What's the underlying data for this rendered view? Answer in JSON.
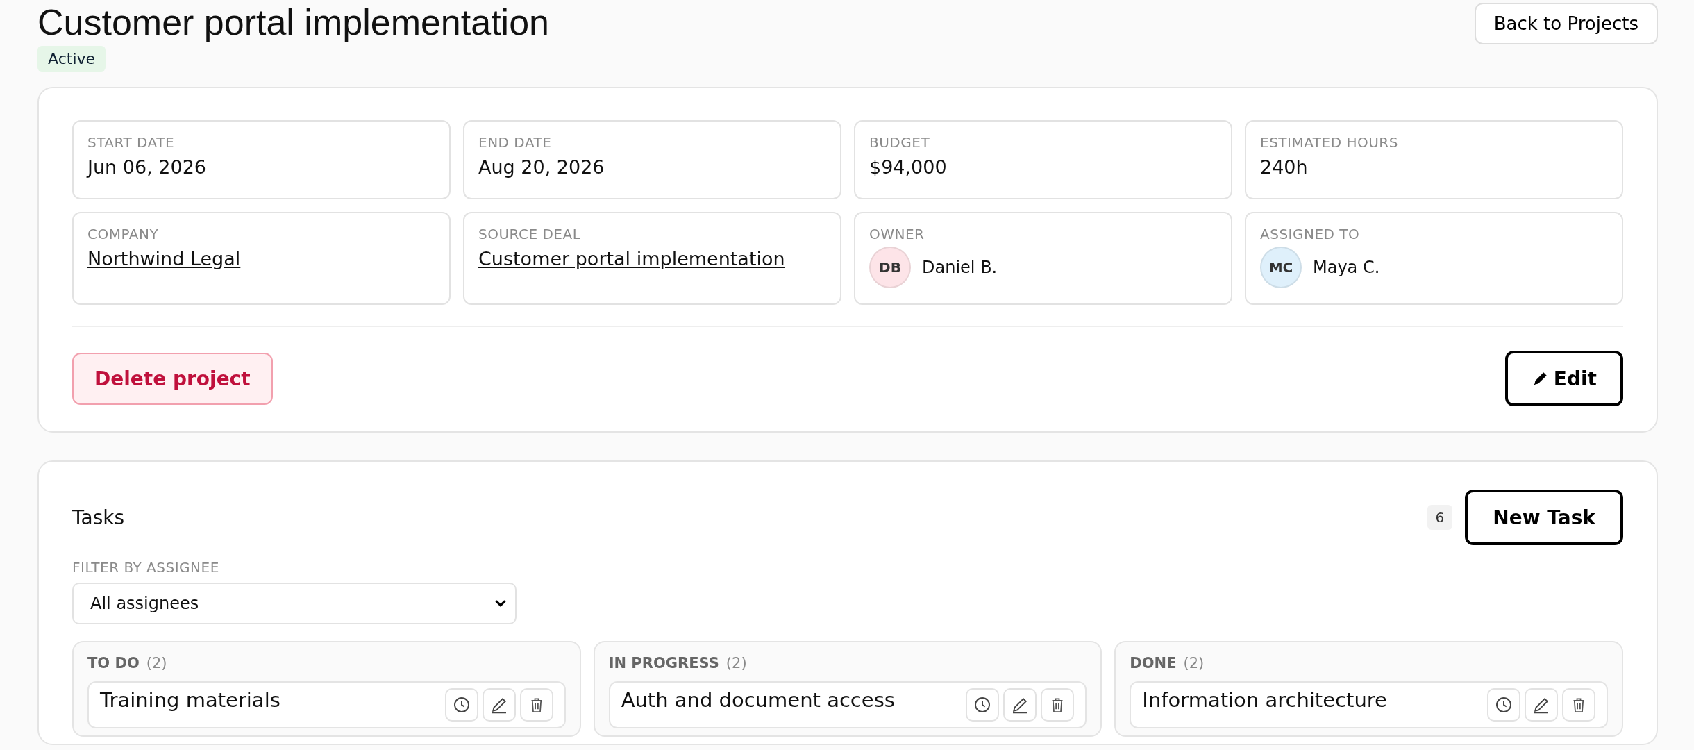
{
  "header": {
    "title": "Customer portal implementation",
    "status": "Active",
    "back_button": "Back to Projects"
  },
  "details": [
    {
      "kind": "text",
      "label": "START DATE",
      "value": "Jun 06, 2026"
    },
    {
      "kind": "text",
      "label": "END DATE",
      "value": "Aug 20, 2026"
    },
    {
      "kind": "text",
      "label": "BUDGET",
      "value": "$94,000"
    },
    {
      "kind": "text",
      "label": "ESTIMATED HOURS",
      "value": "240h"
    },
    {
      "kind": "link",
      "label": "COMPANY",
      "value": "Northwind Legal"
    },
    {
      "kind": "link",
      "label": "SOURCE DEAL",
      "value": "Customer portal implementation"
    },
    {
      "kind": "person",
      "label": "OWNER",
      "initials": "DB",
      "value": "Daniel B.",
      "color": "#fde4e8"
    },
    {
      "kind": "person",
      "label": "ASSIGNED TO",
      "initials": "MC",
      "value": "Maya C.",
      "color": "#dff0fb"
    }
  ],
  "actions": {
    "delete": "Delete project",
    "edit": "Edit"
  },
  "tasks": {
    "title": "Tasks",
    "count": "6",
    "new_button": "New Task",
    "filter_label": "FILTER BY ASSIGNEE",
    "filter_value": "All assignees",
    "columns": [
      {
        "title": "TO DO",
        "count": "(2)",
        "tasks": [
          {
            "title": "Training materials"
          }
        ]
      },
      {
        "title": "IN PROGRESS",
        "count": "(2)",
        "tasks": [
          {
            "title": "Auth and document access"
          }
        ]
      },
      {
        "title": "DONE",
        "count": "(2)",
        "tasks": [
          {
            "title": "Information architecture"
          }
        ]
      }
    ]
  }
}
